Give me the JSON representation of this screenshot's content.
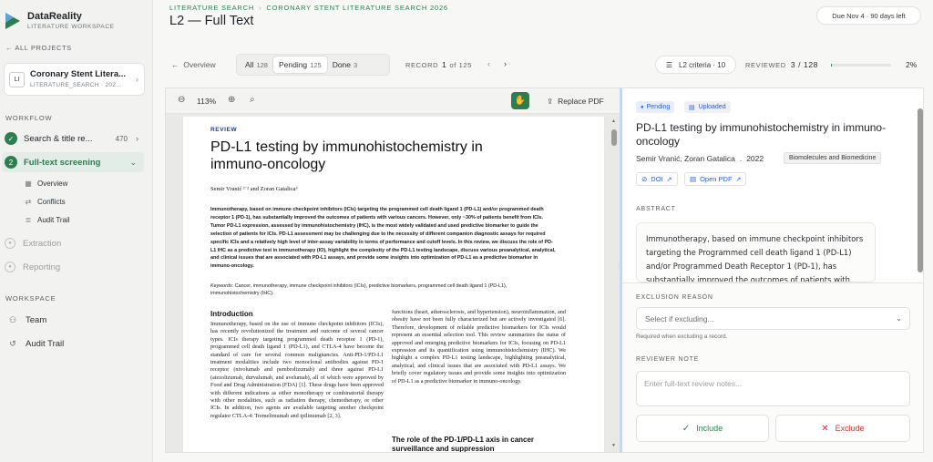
{
  "sidebar": {
    "brand_name": "DataReality",
    "brand_sub": "LITERATURE WORKSPACE",
    "all_projects": "ALL PROJECTS",
    "project": {
      "badge": "LI",
      "name": "Coronary Stent Litera...",
      "code": "LITERATURE_SEARCH · 202..."
    },
    "workflow_label": "WORKFLOW",
    "workflow": [
      {
        "label": "Search & title re...",
        "count": "470",
        "state": "done"
      },
      {
        "label": "Full-text screening",
        "step": "2",
        "state": "active"
      }
    ],
    "sub_items": [
      {
        "icon": "grid-icon",
        "label": "Overview"
      },
      {
        "icon": "shuffle-icon",
        "label": "Conflicts"
      },
      {
        "icon": "list-icon",
        "label": "Audit Trail"
      }
    ],
    "disabled": [
      {
        "label": "Extraction"
      },
      {
        "label": "Reporting"
      }
    ],
    "workspace_label": "WORKSPACE",
    "workspace": [
      {
        "icon": "team-icon",
        "label": "Team"
      },
      {
        "icon": "history-icon",
        "label": "Audit Trail"
      }
    ]
  },
  "header": {
    "crumb_1": "LITERATURE SEARCH",
    "crumb_2": "CORONARY STENT LITERATURE SEARCH 2026",
    "title": "L2 — Full Text",
    "due": "Due Nov 4 · 90 days left"
  },
  "toolbar": {
    "back": "Overview",
    "filters": [
      {
        "label": "All",
        "count": "128"
      },
      {
        "label": "Pending",
        "count": "125"
      },
      {
        "label": "Done",
        "count": "3"
      }
    ],
    "record_label": "RECORD",
    "record_index": "1",
    "record_of": "of 125",
    "criteria": "L2 criteria · 10",
    "reviewed_label": "REVIEWED",
    "reviewed_value": "3 / 128",
    "progress_pct_label": "2%",
    "progress_fraction": 0.02
  },
  "pdf": {
    "zoom": "113%",
    "replace": "Replace PDF",
    "page": {
      "kicker": "REVIEW",
      "title": "PD-L1 testing by immunohistochemistry in immuno-oncology",
      "authors": "Semir Vranić ¹˙² and Zoran Gatalica³",
      "abstract": "Immunotherapy, based on immune checkpoint inhibitors (ICIs) targeting the programmed cell death ligand 1 (PD-L1) and/or programmed death receptor 1 (PD-1), has substantially improved the outcomes of patients with various cancers. However, only ~30% of patients benefit from ICIs. Tumor PD-L1 expression, assessed by immunohistochemistry (IHC), is the most widely validated and used predictive biomarker to guide the selection of patients for ICIs. PD-L1 assessment may be challenging due to the necessity of different companion diagnostic assays for required specific ICIs and a relatively high level of inter-assay variability in terms of performance and cutoff levels. In this review, we discuss the role of PD-L1 IHC as a predictive test in immunotherapy (IO), highlight the complexity of the PD-L1 testing landscape, discuss various preanalytical, analytical, and clinical issues that are associated with PD-L1 assays, and provide some insights into optimization of PD-L1 as a predictive biomarker in immuno-oncology.",
      "keywords_label": "Keywords:",
      "keywords": "Cancer, immunotherapy, immune checkpoint inhibitors (ICIs), predictive biomarkers, programmed cell death ligand 1 (PD-L1), immunohistochemistry (IHC).",
      "intro_heading": "Introduction",
      "col1": "Immunotherapy, based on the use of immune checkpoint inhibitors (ICIs), has recently revolutionized the treatment and outcome of several cancer types. ICIs therapy targeting programmed death receptor 1 (PD-1), programmed cell death ligand 1 (PD-L1), and CTLA-4 have become the standard of care for several common malignancies. Anti-PD-1/PD-L1 treatment modalities include two monoclonal antibodies against PD-1 receptor (nivolumab and pembrolizumab) and three against PD-L1 (atezolizumab, durvalumab, and avelumab), all of which were approved by Food and Drug Administration (FDA) [1]. These drugs have been approved with different indications as either monotherapy or combinatorial therapy with other modalities, such as radiation therapy, chemotherapy, or other ICIs. In addition, two agents are available targeting another checkpoint regulator CTLA-4: Tremelimumab and ipilimumab [2, 3].",
      "col2": "functions (heart, atherosclerosis, and hypertension), neuroinflammation, and obesity have not been fully characterized but are actively investigated [6]. Therefore, development of reliable predictive biomarkers for ICIs would represent an essential selection tool. This review summarizes the status of approved and emerging predictive biomarkers for ICIs, focusing on PD-L1 expression and its quantification using immunohistochemistry (IHC). We highlight a complex PD-L1 testing landscape, highlighting preanalytical, analytical, and clinical issues that are associated with PD-L1 assays. We briefly cover regulatory issues and provide some insights into optimization of PD-L1 as a predictive biomarker in immuno-oncology.",
      "section_heading": "The role of the PD-1/PD-L1 axis in cancer surveillance and suppression"
    }
  },
  "detail": {
    "badge_pending": "Pending",
    "badge_uploaded": "Uploaded",
    "title": "PD-L1 testing by immunohistochemistry in immuno-oncology",
    "authors": "Semir Vranić, Zoran Gatalica",
    "year": "2022",
    "journal": "Biomolecules and Biomedicine",
    "doi": "DOI",
    "open_pdf": "Open PDF",
    "abstract_label": "ABSTRACT",
    "abstract": "Immunotherapy, based on immune checkpoint inhibitors targeting the Programmed cell death ligand 1 (PD-L1) and/or Programmed Death Receptor 1 (PD-1), has substantially improved the outcomes of patients with various cancers.",
    "exclusion_label": "EXCLUSION REASON",
    "exclusion_placeholder": "Select if excluding...",
    "exclusion_helper": "Required when excluding a record.",
    "note_label": "REVIEWER NOTE",
    "note_placeholder": "Enter full-text review notes...",
    "include": "Include",
    "exclude": "Exclude"
  }
}
